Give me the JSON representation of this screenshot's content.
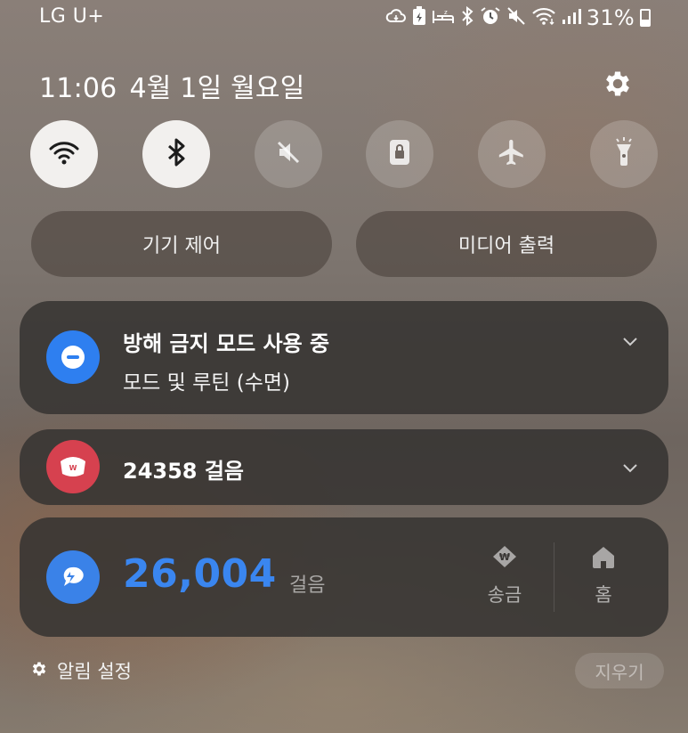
{
  "status_bar": {
    "carrier": "LG U+",
    "battery": "31%",
    "icons": [
      "cloud-sync-icon",
      "battery-saver-icon",
      "sleep-mode-icon",
      "bluetooth-icon",
      "alarm-icon",
      "mute-icon",
      "wifi-icon",
      "signal-icon"
    ]
  },
  "header": {
    "time": "11:06",
    "date": "4월 1일 월요일"
  },
  "quick_settings": [
    {
      "icon": "wifi-icon",
      "state": "on"
    },
    {
      "icon": "bluetooth-icon",
      "state": "on"
    },
    {
      "icon": "mute-icon",
      "state": "off"
    },
    {
      "icon": "lock-icon",
      "state": "off"
    },
    {
      "icon": "airplane-icon",
      "state": "off"
    },
    {
      "icon": "flashlight-icon",
      "state": "off"
    }
  ],
  "pills": {
    "device_control": "기기 제어",
    "media_output": "미디어 출력"
  },
  "notifications": {
    "dnd": {
      "title": "방해 금지 모드 사용 중",
      "subtitle": "모드 및 루틴 (수면)"
    },
    "steps": {
      "text": "24358 걸음"
    },
    "toss": {
      "number": "26,004",
      "unit": "걸음",
      "send_label": "송금",
      "home_label": "홈"
    }
  },
  "footer": {
    "settings_label": "알림 설정",
    "clear_label": "지우기"
  },
  "colors": {
    "accent_blue": "#2e7ff0",
    "toss_number": "#3a86f0",
    "steps_red": "#d6414f"
  }
}
